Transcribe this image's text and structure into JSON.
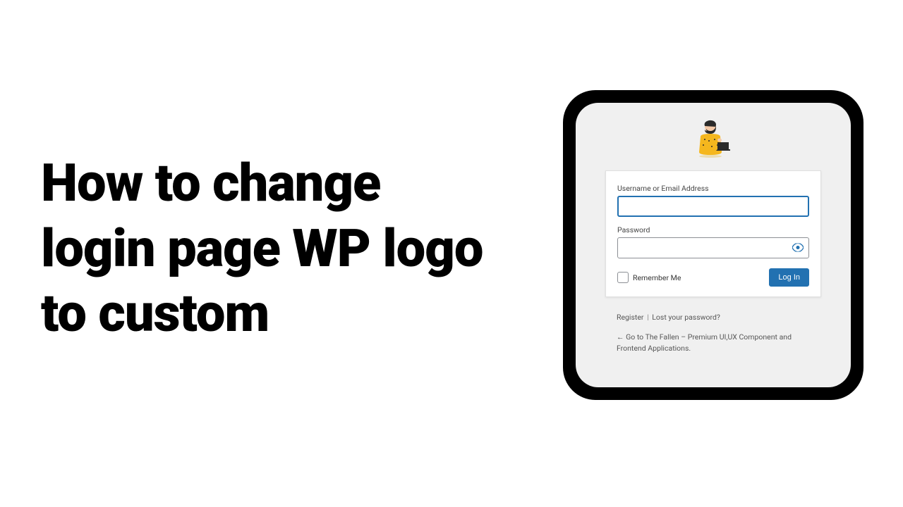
{
  "headline": "How to change login page WP logo to custom",
  "login": {
    "username_label": "Username or Email Address",
    "password_label": "Password",
    "remember_label": "Remember Me",
    "button_label": "Log In"
  },
  "links": {
    "register": "Register",
    "lost_password": "Lost your password?",
    "back_arrow": "←",
    "back_text": "Go to The Fallen – Premium UI,UX Component and Frontend Applications."
  }
}
